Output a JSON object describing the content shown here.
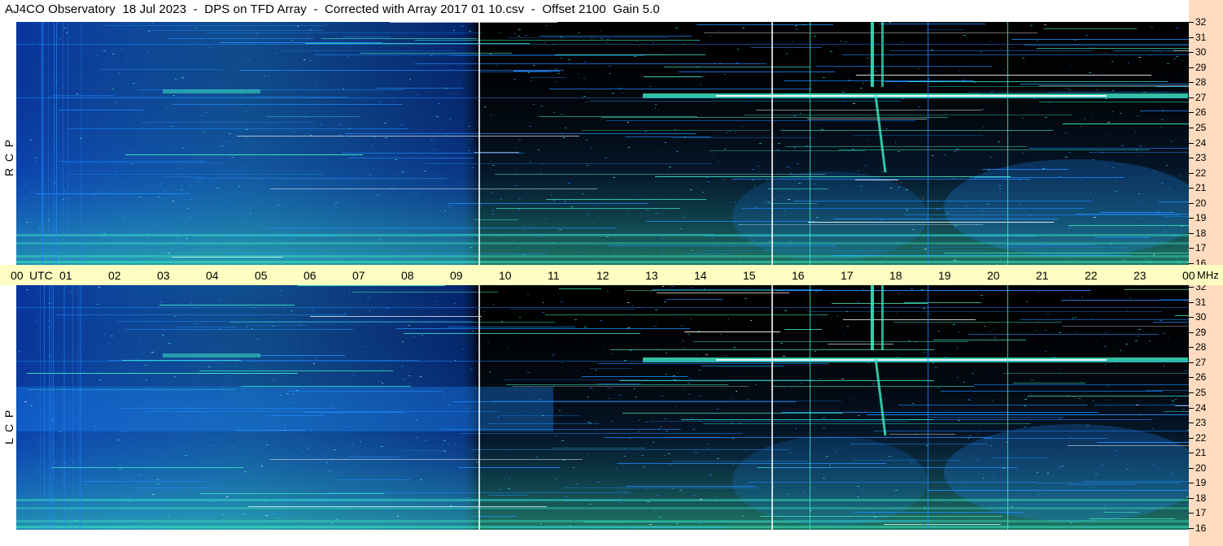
{
  "title": "AJ4CO Observatory  18 Jul 2023  -  DPS on TFD Array  -  Corrected with Array 2017 01 10.csv  -  Offset 2100  Gain 5.0",
  "panels": [
    {
      "id": "rcp",
      "label": "R  C  P"
    },
    {
      "id": "lcp",
      "label": "L  C  P"
    }
  ],
  "time_axis": {
    "labels": [
      "00",
      "UTC",
      "01",
      "02",
      "03",
      "04",
      "05",
      "06",
      "07",
      "08",
      "09",
      "10",
      "11",
      "12",
      "13",
      "14",
      "15",
      "16",
      "17",
      "18",
      "19",
      "20",
      "21",
      "22",
      "23",
      "00"
    ],
    "unit": "MHz"
  },
  "freq_axis": {
    "labels": [
      "32",
      "31",
      "30",
      "29",
      "28",
      "27",
      "26",
      "25",
      "24",
      "23",
      "22",
      "21",
      "20",
      "19",
      "18",
      "17",
      "16"
    ]
  },
  "colors": {
    "background": "#000000",
    "low_signal": "#0a3fb8",
    "mid_signal": "#1e8cff",
    "high_signal": "#3ff0c8",
    "peak_signal": "#ffffff",
    "axis_bar": "#fffec2",
    "freq_scale": "#ffdcc0"
  }
}
